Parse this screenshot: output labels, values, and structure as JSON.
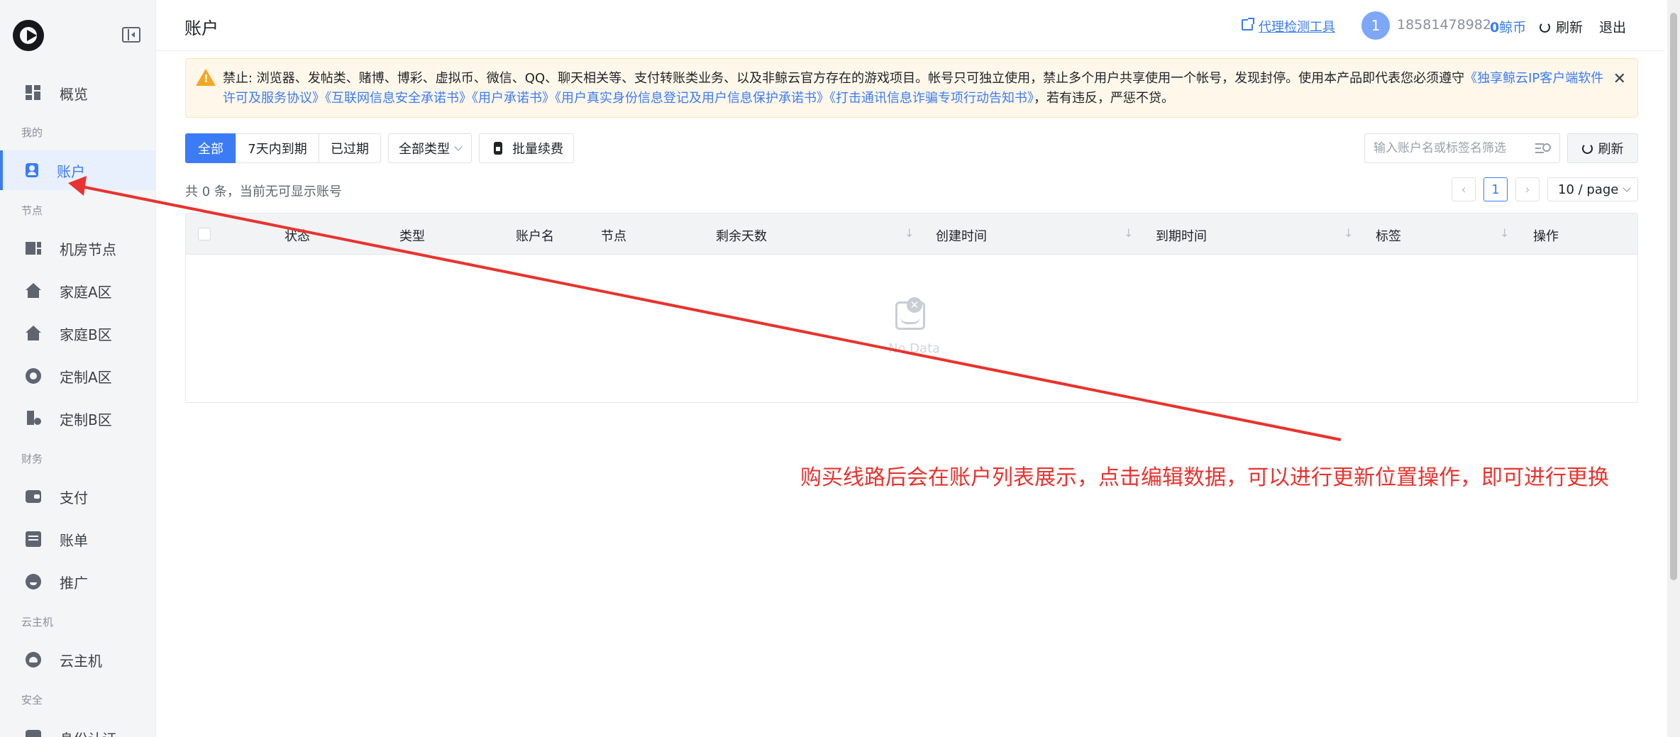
{
  "sidebar": {
    "sections": {
      "mine": "我的",
      "nodes": "节点",
      "finance": "财务",
      "cloud": "云主机",
      "security": "安全"
    },
    "items": {
      "overview": "概览",
      "account": "账户",
      "datacenter": "机房节点",
      "home_a": "家庭A区",
      "home_b": "家庭B区",
      "custom_a": "定制A区",
      "custom_b": "定制B区",
      "pay": "支付",
      "bill": "账单",
      "promo": "推广",
      "cloud_host": "云主机",
      "identity": "身份认证"
    }
  },
  "header": {
    "title": "账户",
    "proxy_tool": "代理检测工具",
    "avatar_initial": "1",
    "phone": "18581478982",
    "coin_value": "0",
    "coin_unit": "鲸币",
    "refresh": "刷新",
    "logout": "退出"
  },
  "notice": {
    "text_a": "禁止: 浏览器、发帖类、赌博、博彩、虚拟币、微信、QQ、聊天相关等、支付转账类业务、以及非鲸云官方存在的游戏项目。帐号只可独立使用，禁止多个用户共享使用一个帐号，发现封停。使用本产品即代表您必须遵守",
    "link_1": "《独享鲸云IP客户端软件许可及服务协议》",
    "link_2": "《互联网信息安全承诺书》",
    "link_3": "《用户承诺书》",
    "link_4": "《用户真实身份信息登记及用户信息保护承诺书》",
    "link_5": "《打击通讯信息诈骗专项行动告知书》",
    "text_b": "，若有违反，严惩不贷。"
  },
  "toolbar": {
    "filter_all": "全部",
    "filter_7days": "7天内到期",
    "filter_expired": "已过期",
    "type_select": "全部类型",
    "batch_renew": "批量续费",
    "search_placeholder": "输入账户名或标签名筛选",
    "refresh": "刷新"
  },
  "list": {
    "total_text": "共 0 条，当前无可显示账号",
    "current_page": "1",
    "page_size": "10 / page"
  },
  "table": {
    "columns": {
      "status": "状态",
      "type": "类型",
      "account_name": "账户名",
      "node": "节点",
      "remaining_days": "剩余天数",
      "created": "创建时间",
      "expiry": "到期时间",
      "tag": "标签",
      "action": "操作"
    },
    "empty_text": "No Data"
  },
  "annotation": {
    "text": "购买线路后会在账户列表展示，点击编辑数据，可以进行更新位置操作，即可进行更换",
    "color": "#e8332e"
  },
  "colors": {
    "accent": "#3b7cf6",
    "warning": "#f5a623"
  }
}
